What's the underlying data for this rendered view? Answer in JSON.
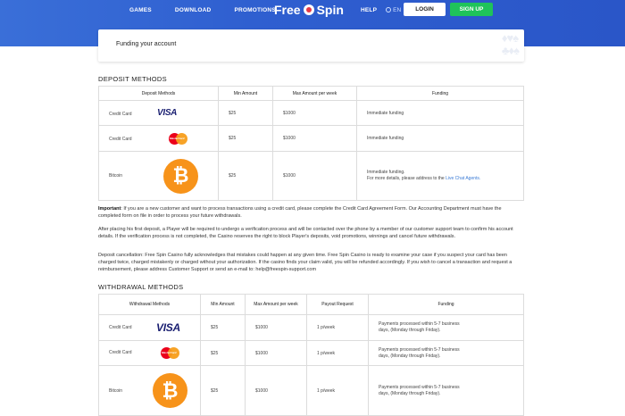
{
  "header": {
    "nav_left": [
      "GAMES",
      "DOWNLOAD",
      "PROMOTIONS"
    ],
    "logo_left": "Free",
    "logo_right": "Spin",
    "help": "HELP",
    "lang": "EN",
    "login": "LOGIN",
    "signup": "SIGN UP"
  },
  "page_title": "Funding your account",
  "deposit": {
    "title": "DEPOSIT METHODS",
    "headers": [
      "Deposit Methods",
      "Min Amount",
      "Max Amount per week",
      "Funding"
    ],
    "rows": [
      {
        "method": "Credit Card",
        "logo": "VISA",
        "min": "$25",
        "max": "$1000",
        "funding": "Immediate funding"
      },
      {
        "method": "Credit Card",
        "logo": "MasterCard",
        "min": "$25",
        "max": "$1000",
        "funding": "Immediate funding"
      },
      {
        "method": "Bitcoin",
        "logo": "₿",
        "min": "$25",
        "max": "$1000",
        "funding": "Immediate funding.",
        "funding2": "For more details, please address to the",
        "funding_link": "Live Chat Agents."
      }
    ]
  },
  "paragraphs": {
    "important_label": "Important",
    "important": ": If you are a new customer and want to process transactions using a credit card, please complete the Credit Card Agreement Form. Our Accounting Department must have the completed form on file in order to process your future withdrawals.",
    "p2": "After placing his first deposit, a Player will be required to undergo a verification process and will be contacted over the phone by a member of our customer support team to confirm his account details. If the verification process is not completed, the Casino reserves the right to block Player's deposits, void promotions, winnings and cancel future withdrawals.",
    "p3": "Deposit cancellation: Free Spin Casino fully acknowledges that mistakes could happen at any given time. Free Spin Casino is ready to examine your case if you suspect your card has been charged twice, charged mistakenly or charged without your authorization. If the casino finds your claim valid, you will be refunded accordingly. If you wish to cancel a transaction and request a reimbursement, please address Customer Support or send an e-mail to: help@freespin-support.com"
  },
  "withdrawal": {
    "title": "WITHDRAWAL METHODS",
    "headers": [
      "Withdrawal Methods",
      "Min Amount",
      "Max Amount per week",
      "Payout Request",
      "Funding"
    ],
    "rows": [
      {
        "method": "Credit Card",
        "logo": "VISA",
        "min": "$25",
        "max": "$1000",
        "payout": "1 p/week",
        "funding": "Payments processed within 5-7 business days, (Monday through Friday)."
      },
      {
        "method": "Credit Card",
        "logo": "MasterCard",
        "min": "$25",
        "max": "$1000",
        "payout": "1 p/week",
        "funding": "Payments processed within 5-7 business days, (Monday through Friday)."
      },
      {
        "method": "Bitcoin",
        "logo": "₿",
        "min": "$25",
        "max": "$1000",
        "payout": "1 p/week",
        "funding": "Payments processed within 5-7 business days, (Monday through Friday)."
      }
    ]
  },
  "colors": {
    "header": "#2f5fd0",
    "signup": "#1fc35a",
    "link": "#3a7bd5",
    "bitcoin": "#f7931a"
  }
}
